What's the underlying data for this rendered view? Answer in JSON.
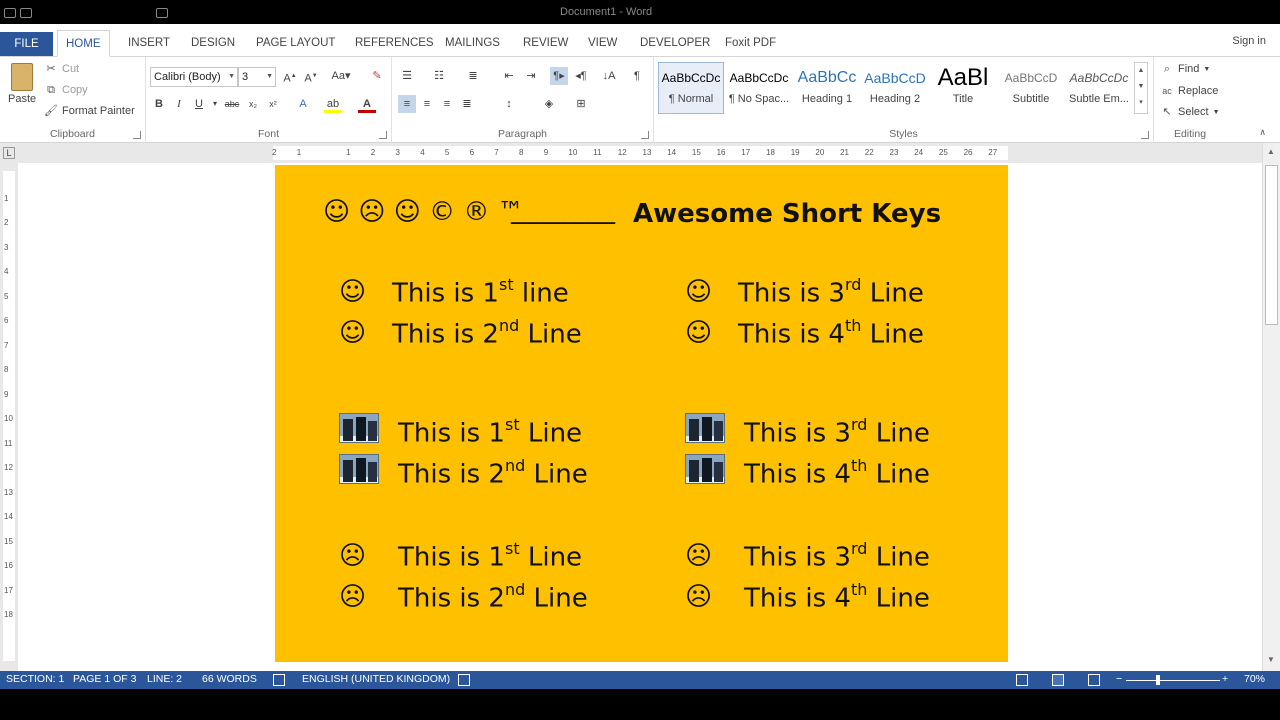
{
  "window": {
    "title": "Document1 - Word"
  },
  "tabs": [
    "FILE",
    "HOME",
    "INSERT",
    "DESIGN",
    "PAGE LAYOUT",
    "REFERENCES",
    "MAILINGS",
    "REVIEW",
    "VIEW",
    "DEVELOPER",
    "Foxit PDF"
  ],
  "active_tab": "HOME",
  "signin": "Sign in",
  "clipboard": {
    "paste": "Paste",
    "cut": "Cut",
    "copy": "Copy",
    "format_painter": "Format Painter",
    "label": "Clipboard"
  },
  "font": {
    "name": "Calibri (Body)",
    "size": "3",
    "label": "Font"
  },
  "paragraph": {
    "label": "Paragraph"
  },
  "styles": {
    "label": "Styles",
    "items": [
      {
        "preview": "AaBbCcDc",
        "name": "¶ Normal"
      },
      {
        "preview": "AaBbCcDc",
        "name": "¶ No Spac..."
      },
      {
        "preview": "AaBbCc",
        "name": "Heading 1"
      },
      {
        "preview": "AaBbCcD",
        "name": "Heading 2"
      },
      {
        "preview": "AaBl",
        "name": "Title"
      },
      {
        "preview": "AaBbCcD",
        "name": "Subtitle"
      },
      {
        "preview": "AaBbCcDc",
        "name": "Subtle Em..."
      }
    ]
  },
  "editing": {
    "find": "Find",
    "replace": "Replace",
    "select": "Select",
    "label": "Editing"
  },
  "document": {
    "header_symbols": "☺ ☹ ☺ © ® ™",
    "header_blank": "________",
    "header_title": "Awesome Short Keys",
    "rows": [
      {
        "left_pre": "This is 1",
        "left_sup": "st",
        "left_post": " line",
        "right_pre": "This is 3",
        "right_sup": "rd",
        "right_post": " Line"
      },
      {
        "left_pre": "This is 2",
        "left_sup": "nd",
        "left_post": " Line",
        "right_pre": "This is 4",
        "right_sup": "th",
        "right_post": " Line"
      },
      {
        "left_pre": "This is 1",
        "left_sup": "st",
        "left_post": " Line",
        "right_pre": "This is 3",
        "right_sup": "rd",
        "right_post": " Line"
      },
      {
        "left_pre": "This is 2",
        "left_sup": "nd",
        "left_post": " Line",
        "right_pre": "This is 4",
        "right_sup": "th",
        "right_post": " Line"
      },
      {
        "left_pre": "This is 1",
        "left_sup": "st",
        "left_post": " Line",
        "right_pre": "This is 3",
        "right_sup": "rd",
        "right_post": " Line"
      },
      {
        "left_pre": "This is 2",
        "left_sup": "nd",
        "left_post": " Line",
        "right_pre": "This is 4",
        "right_sup": "th",
        "right_post": " Line"
      }
    ],
    "smile": "☺",
    "frown": "☹",
    "page_color": "#ffc000"
  },
  "status": {
    "section": "SECTION: 1",
    "page": "PAGE 1 OF 3",
    "line": "LINE: 2",
    "words": "66 WORDS",
    "language": "ENGLISH (UNITED KINGDOM)",
    "zoom": "70%"
  },
  "colors": {
    "accent": "#2b579a"
  }
}
